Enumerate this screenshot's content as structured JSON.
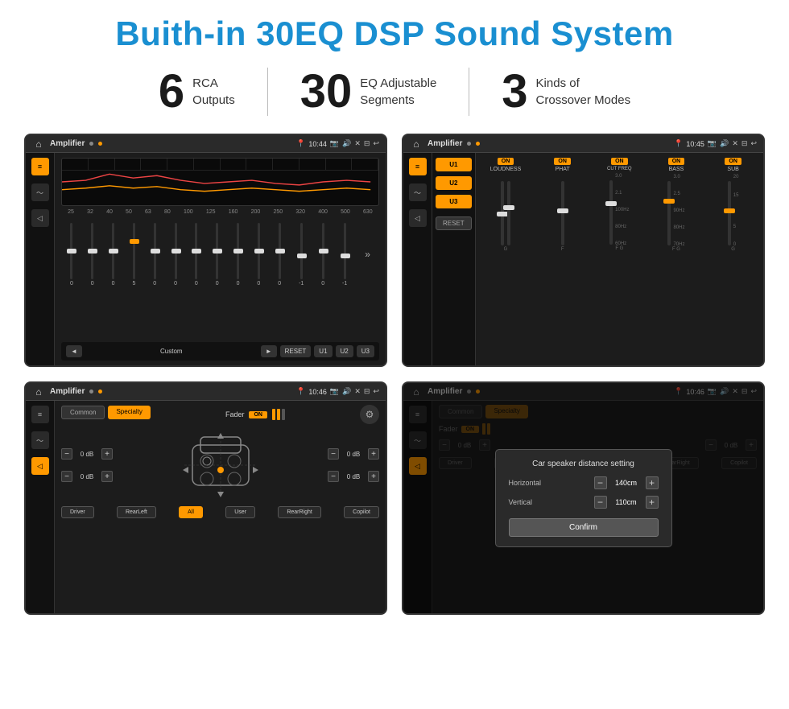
{
  "page": {
    "title": "Buith-in 30EQ DSP Sound System",
    "stats": [
      {
        "number": "6",
        "label": "RCA\nOutputs"
      },
      {
        "number": "30",
        "label": "EQ Adjustable\nSegments"
      },
      {
        "number": "3",
        "label": "Kinds of\nCrossover Modes"
      }
    ],
    "screens": [
      {
        "id": "screen-eq",
        "topbar_title": "Amplifier",
        "topbar_time": "10:44",
        "type": "eq"
      },
      {
        "id": "screen-crossover",
        "topbar_title": "Amplifier",
        "topbar_time": "10:45",
        "type": "crossover"
      },
      {
        "id": "screen-fader",
        "topbar_title": "Amplifier",
        "topbar_time": "10:46",
        "type": "fader"
      },
      {
        "id": "screen-distance",
        "topbar_title": "Amplifier",
        "topbar_time": "10:46",
        "type": "distance"
      }
    ],
    "eq": {
      "freq_labels": [
        "25",
        "32",
        "40",
        "50",
        "63",
        "80",
        "100",
        "125",
        "160",
        "200",
        "250",
        "320",
        "400",
        "500",
        "630"
      ],
      "values": [
        "0",
        "0",
        "0",
        "5",
        "0",
        "0",
        "0",
        "0",
        "0",
        "0",
        "0",
        "-1",
        "0",
        "-1"
      ],
      "preset": "Custom",
      "buttons": [
        "RESET",
        "U1",
        "U2",
        "U3"
      ]
    },
    "crossover": {
      "presets": [
        "U1",
        "U2",
        "U3"
      ],
      "channels": [
        {
          "name": "LOUDNESS",
          "on": true
        },
        {
          "name": "PHAT",
          "on": true
        },
        {
          "name": "CUT FREQ",
          "on": true
        },
        {
          "name": "BASS",
          "on": true
        },
        {
          "name": "SUB",
          "on": true
        }
      ],
      "reset_label": "RESET"
    },
    "fader": {
      "tabs": [
        "Common",
        "Specialty"
      ],
      "fader_label": "Fader",
      "on_label": "ON",
      "vol_values": [
        "0 dB",
        "0 dB",
        "0 dB",
        "0 dB"
      ],
      "buttons": [
        "Driver",
        "RearLeft",
        "All",
        "User",
        "RearRight",
        "Copilot"
      ]
    },
    "distance_dialog": {
      "title": "Car speaker distance setting",
      "horizontal_label": "Horizontal",
      "horizontal_value": "140cm",
      "vertical_label": "Vertical",
      "vertical_value": "110cm",
      "confirm_label": "Confirm",
      "vol_values": [
        "0 dB",
        "0 dB"
      ]
    }
  }
}
